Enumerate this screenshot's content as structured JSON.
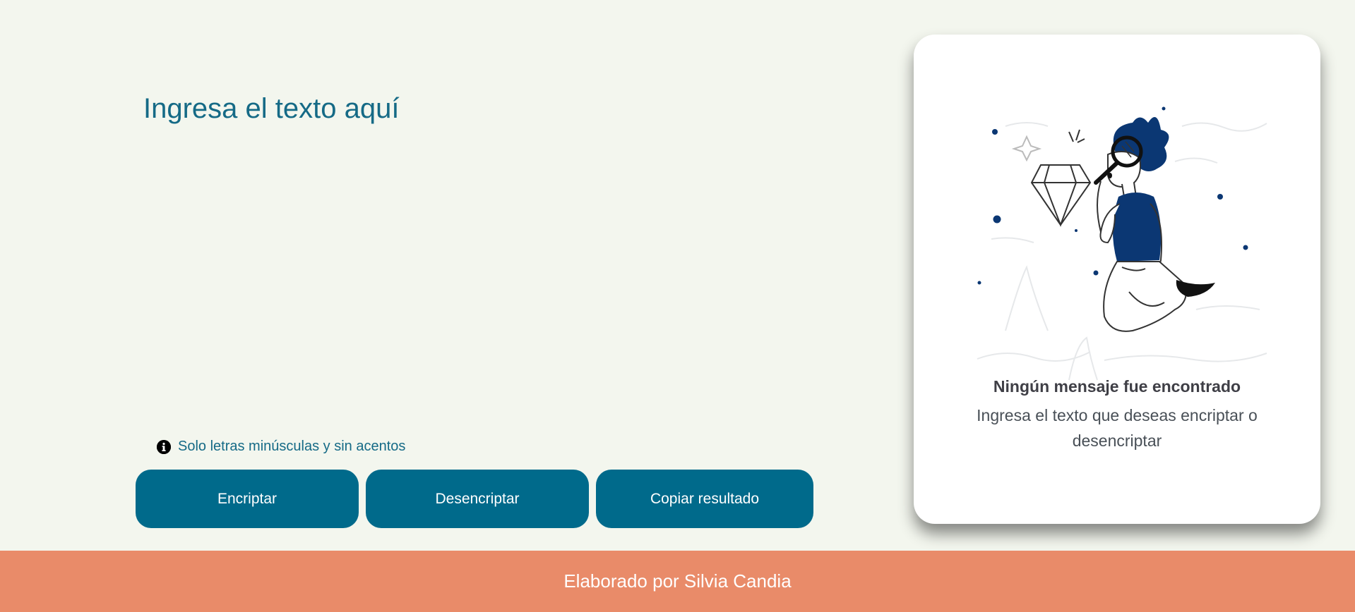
{
  "input": {
    "placeholder": "Ingresa el texto aquí",
    "value": ""
  },
  "hint": {
    "icon": "info-icon",
    "text": "Solo letras minúsculas y sin acentos"
  },
  "buttons": {
    "encrypt_label": "Encriptar",
    "decrypt_label": "Desencriptar",
    "copy_label": "Copiar resultado"
  },
  "result_card": {
    "image": "person-with-magnifying-glass-illustration",
    "title": "Ningún mensaje fue encontrado",
    "text": "Ingresa el texto que deseas encriptar o desencriptar"
  },
  "footer": {
    "text": "Elaborado por Silvia Candia"
  },
  "colors": {
    "background": "#f3f6ee",
    "accent": "#006a8b",
    "footer": "#e98b69",
    "illustration": "#0b3773"
  }
}
